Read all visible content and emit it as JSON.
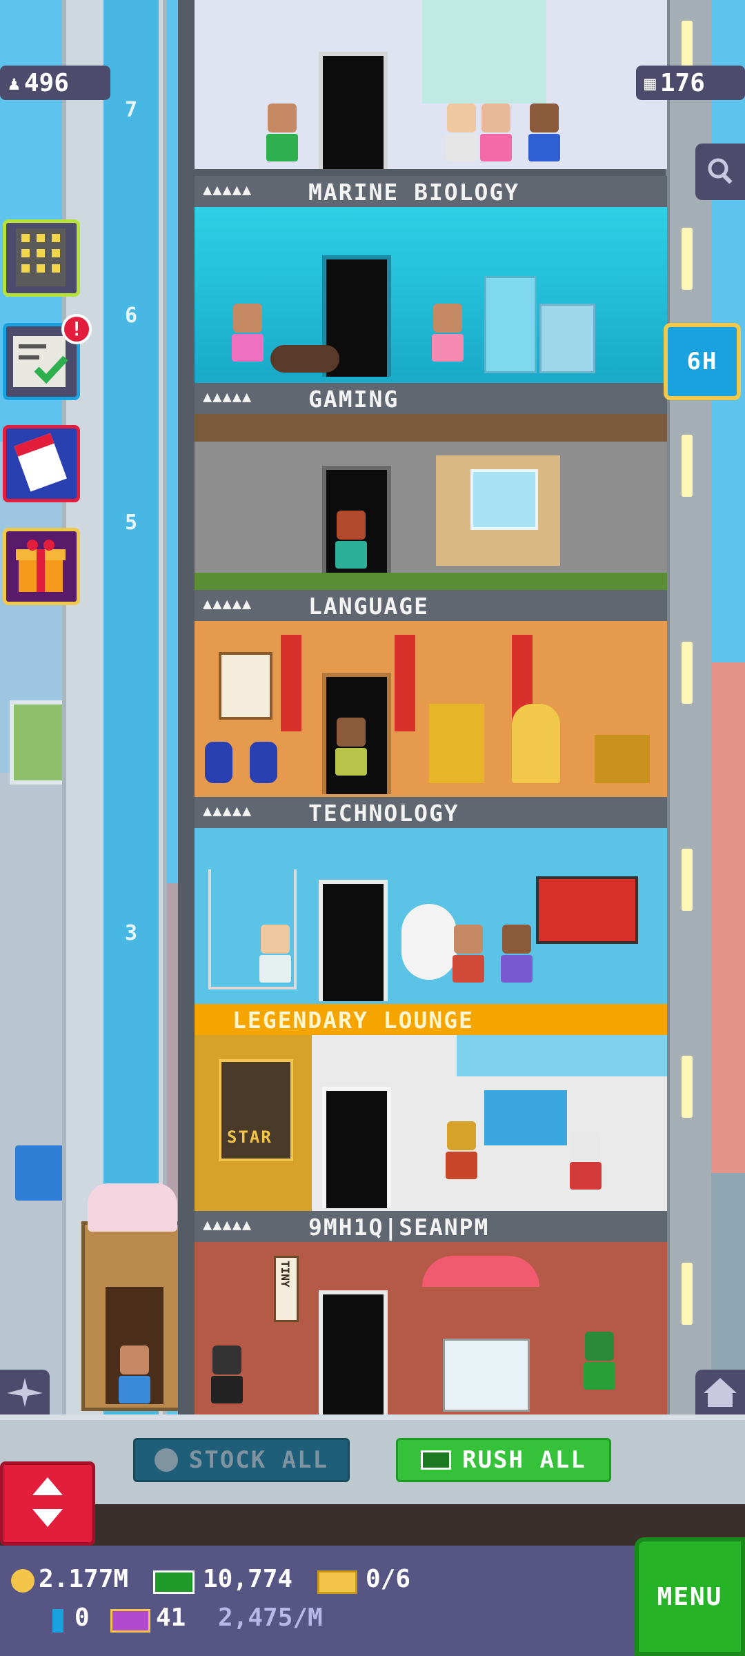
{
  "top": {
    "population": "496",
    "floors_count": "176"
  },
  "elevator_floor_numbers": [
    "7",
    "6",
    "5",
    "3"
  ],
  "side_timer": "6H",
  "floors": [
    {
      "stars": "▲▲▲▲▲",
      "name": "MARINE BIOLOGY"
    },
    {
      "stars": "▲▲▲▲▲",
      "name": "GAMING"
    },
    {
      "stars": "▲▲▲▲▲",
      "name": "LANGUAGE"
    },
    {
      "stars": "▲▲▲▲▲",
      "name": "TECHNOLOGY"
    },
    {
      "stars": "",
      "name": "LEGENDARY LOUNGE"
    },
    {
      "stars": "▲▲▲▲▲",
      "name": "9MH1Q|SEANPM"
    }
  ],
  "signs": {
    "star_poster": "STAR",
    "tiny_sign": "TINY"
  },
  "actions": {
    "stock_all": "STOCK ALL",
    "rush_all": "RUSH ALL",
    "menu": "MENU"
  },
  "stats": {
    "coins": "2.177M",
    "bux": "10,774",
    "tickets": "0/6",
    "keys": "0",
    "golden": "41",
    "rate": "2,475/M"
  },
  "colors": {
    "menu_green": "#27b327",
    "rush_green": "#35c23a",
    "stock_teal": "#1f5e78",
    "legendary_orange": "#f5a400",
    "elevator_red": "#e21e3c"
  }
}
